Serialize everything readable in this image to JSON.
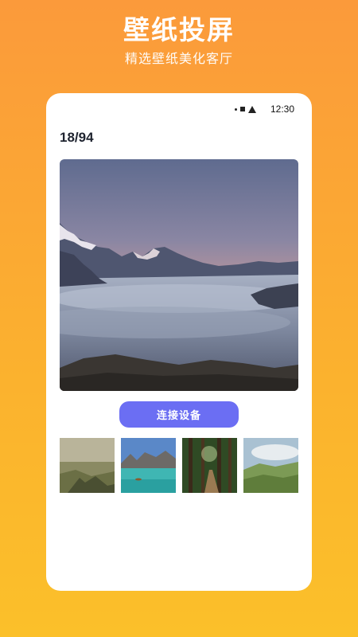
{
  "header": {
    "title": "壁纸投屏",
    "subtitle": "精选壁纸美化客厅"
  },
  "status_bar": {
    "time": "12:30",
    "icons": [
      "dot-icon",
      "square-icon",
      "signal-triangle-icon"
    ]
  },
  "viewer": {
    "counter": "18/94",
    "main_image": "mountain-sea-of-clouds-sunset"
  },
  "connect_button": {
    "label": "连接设备",
    "color": "#6b6ef3"
  },
  "thumbnails": [
    {
      "name": "misty-forest-valley"
    },
    {
      "name": "turquoise-mountain-lake"
    },
    {
      "name": "forest-path"
    },
    {
      "name": "green-hills-clouds"
    }
  ],
  "colors": {
    "background_top": "#fb9a3b",
    "background_bottom": "#fbc02a",
    "card": "#ffffff"
  }
}
